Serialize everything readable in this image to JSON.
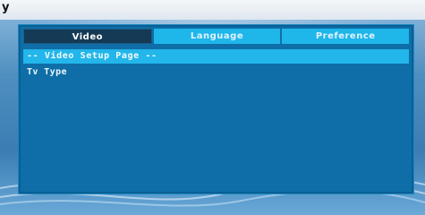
{
  "topbar": {
    "text": "y"
  },
  "tabs": [
    {
      "label": "Video",
      "active": true
    },
    {
      "label": "Language",
      "active": false
    },
    {
      "label": "Preference",
      "active": false
    }
  ],
  "page": {
    "header": "-- Video Setup Page --"
  },
  "items": [
    {
      "label": "Tv Type"
    }
  ],
  "colors": {
    "panel": "#0f6ea7",
    "tab": "#1fb6ea",
    "tab_active": "#143a55",
    "header_bar": "#22b6ea"
  }
}
